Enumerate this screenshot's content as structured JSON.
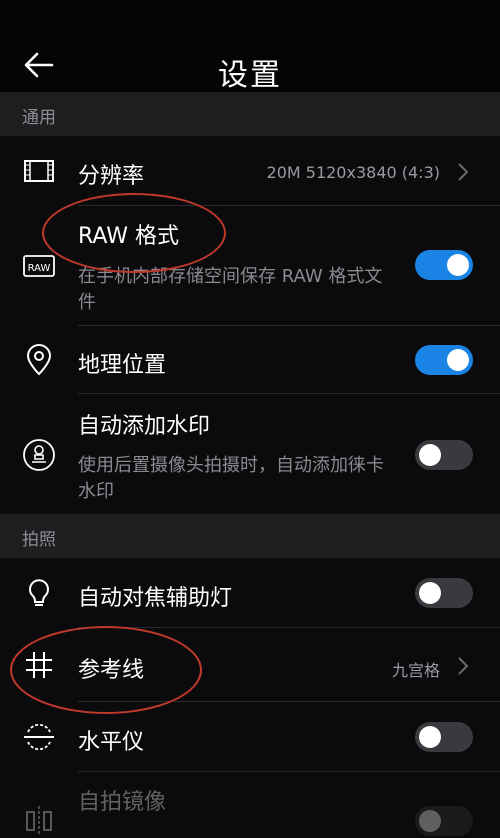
{
  "header": {
    "title": "设置",
    "back_icon": "arrow-left-icon"
  },
  "sections": {
    "general": "通用",
    "photo": "拍照"
  },
  "rows": {
    "resolution": {
      "label": "分辨率",
      "value": "20M 5120x3840 (4:3)",
      "icon": "resolution-frame-icon"
    },
    "raw": {
      "label": "RAW 格式",
      "desc": "在手机内部存储空间保存 RAW 格式文件",
      "toggle_on": true,
      "icon": "raw-icon",
      "icon_text": "RAW"
    },
    "location": {
      "label": "地理位置",
      "toggle_on": true,
      "icon": "location-pin-icon"
    },
    "watermark": {
      "label": "自动添加水印",
      "desc": "使用后置摄像头拍摄时，自动添加徕卡水印",
      "toggle_on": false,
      "icon": "stamp-icon"
    },
    "af_light": {
      "label": "自动对焦辅助灯",
      "toggle_on": false,
      "icon": "lightbulb-icon"
    },
    "grid": {
      "label": "参考线",
      "value": "九宫格",
      "icon": "grid-icon"
    },
    "level": {
      "label": "水平仪",
      "toggle_on": false,
      "icon": "level-icon"
    },
    "mirror": {
      "label": "自拍镜像",
      "toggle_on": false,
      "icon": "mirror-icon"
    }
  },
  "annotations": {
    "circle_color": "#c0392b"
  },
  "colors": {
    "accent": "#1a84e6",
    "background": "#0b0b0d",
    "section_bg": "#1e1e21"
  }
}
